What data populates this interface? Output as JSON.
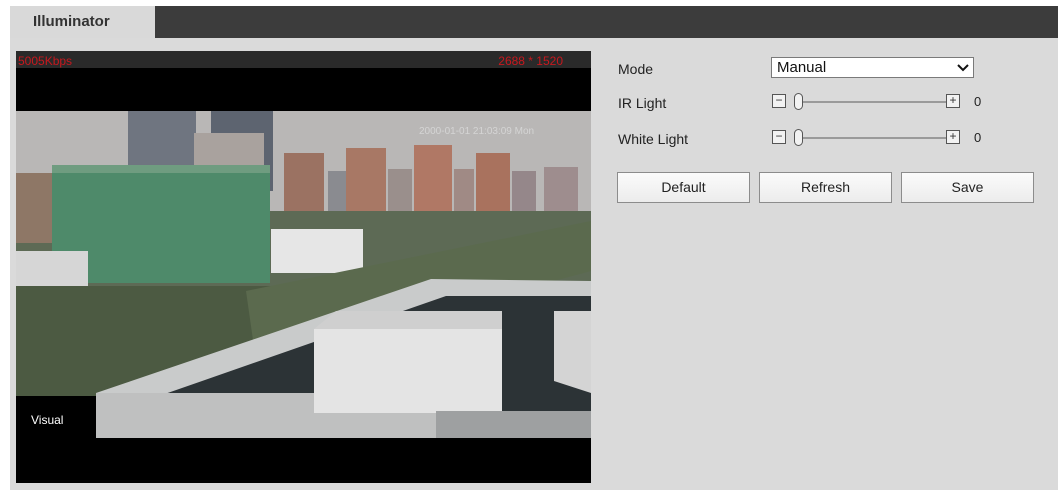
{
  "tab": {
    "title": "Illuminator"
  },
  "video": {
    "bitrate": "5005Kbps",
    "resolution": "2688 * 1520",
    "timestamp": "2000-01-01 21:03:09 Mon",
    "channel_label": "Visual"
  },
  "settings": {
    "mode": {
      "label": "Mode",
      "value": "Manual"
    },
    "ir_light": {
      "label": "IR Light",
      "value": "0",
      "level": 0
    },
    "white_light": {
      "label": "White Light",
      "value": "0",
      "level": 0
    }
  },
  "buttons": {
    "default_label": "Default",
    "refresh_label": "Refresh",
    "save_label": "Save"
  },
  "icons": {
    "minus": "minus-icon",
    "plus": "plus-icon",
    "chevron": "chevron-down-icon"
  },
  "colors": {
    "header_bg": "#3c3c3c",
    "panel_bg": "#dadada",
    "overlay_red": "#c8181e"
  }
}
